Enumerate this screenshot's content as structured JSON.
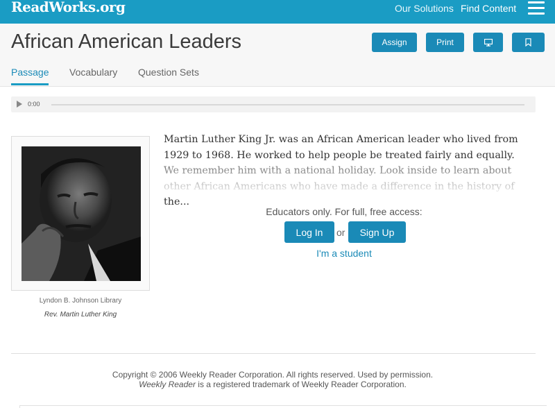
{
  "topbar": {
    "logo": "ReadWorks.org",
    "nav_solutions": "Our Solutions",
    "nav_find": "Find Content",
    "menu_icon": "hamburger-menu-icon"
  },
  "header": {
    "title": "African American Leaders",
    "buttons": {
      "assign": "Assign",
      "print": "Print",
      "present_icon": "monitor-icon",
      "bookmark_icon": "bookmark-icon"
    },
    "tabs": [
      "Passage",
      "Vocabulary",
      "Question Sets"
    ],
    "active_tab": "Passage"
  },
  "audio": {
    "time": "0:00",
    "play_icon": "play-icon",
    "progress": 0
  },
  "figure": {
    "credit": "Lyndon B. Johnson Library",
    "caption": "Rev. Martin Luther King"
  },
  "passage": {
    "text": "Martin Luther King Jr. was an African American leader who lived from 1929 to 1968.  He worked to help people be treated fairly and equally.  We remember him with a national holiday.  Look inside to learn about other African Americans who have made a difference in the history of the..."
  },
  "gate": {
    "message": "Educators only. For full, free access:",
    "login": "Log In",
    "or": "or",
    "signup": "Sign Up",
    "student": "I'm a student"
  },
  "footer": {
    "copyright": "Copyright © 2006 Weekly Reader Corporation. All rights reserved. Used by permission.",
    "trademark_italic": "Weekly Reader",
    "trademark_rest": " is a registered trademark of Weekly Reader Corporation."
  },
  "colors": {
    "brand": "#1a9cc4",
    "button": "#1a8ab7"
  }
}
